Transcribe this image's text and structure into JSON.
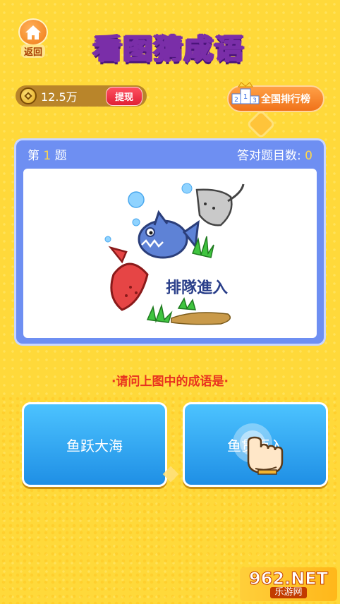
{
  "header": {
    "back_label": "返回",
    "title": "看图猜成语"
  },
  "wallet": {
    "coins": "12.5万",
    "withdraw_label": "提现"
  },
  "rank": {
    "label": "全国排行榜"
  },
  "question": {
    "number_prefix": "第",
    "number": "1",
    "number_suffix": "题",
    "correct_label": "答对题目数:",
    "correct_count": "0",
    "image_text": "排隊進入"
  },
  "prompt": "·请问上图中的成语是·",
  "answers": [
    {
      "label": "鱼跃大海"
    },
    {
      "label": "鱼贯而入"
    }
  ],
  "watermark": {
    "top": "962.NET",
    "bottom": "乐游网"
  }
}
